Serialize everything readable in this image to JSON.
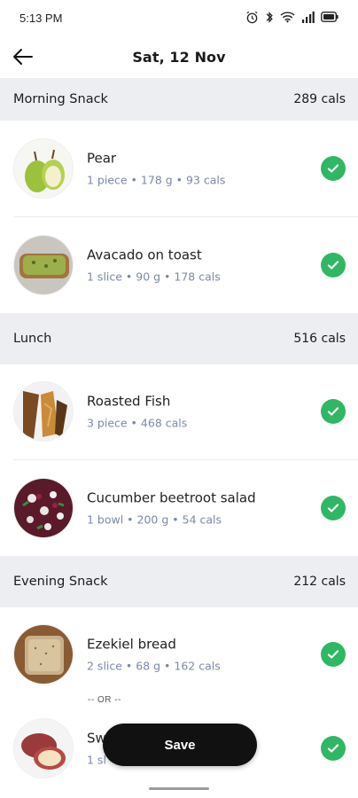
{
  "status_bar": {
    "time": "5:13 PM"
  },
  "header": {
    "title": "Sat, 12 Nov"
  },
  "sections": [
    {
      "name": "Morning Snack",
      "cals": "289 cals",
      "items": [
        {
          "name": "Pear",
          "meta": "1 piece  •  178 g  •  93 cals",
          "icon": "pear-image"
        },
        {
          "name": "Avacado on toast",
          "meta": "1 slice  •  90 g  •  178 cals",
          "icon": "avocado-toast-image"
        }
      ]
    },
    {
      "name": "Lunch",
      "cals": "516 cals",
      "items": [
        {
          "name": "Roasted Fish",
          "meta": "3 piece  •  468 cals",
          "icon": "roasted-fish-image"
        },
        {
          "name": "Cucumber beetroot salad",
          "meta": "1 bowl  •  200 g  •  54 cals",
          "icon": "salad-image"
        }
      ]
    },
    {
      "name": "Evening Snack",
      "cals": "212 cals",
      "items": [
        {
          "name": "Ezekiel bread",
          "meta": "2 slice  •  68 g  •  162 cals",
          "icon": "bread-image"
        },
        {
          "name": "Sw",
          "meta": "1 sl",
          "icon": "sweet-potato-image"
        }
      ],
      "separator": "-- OR --"
    }
  ],
  "save_label": "Save",
  "colors": {
    "check": "#2fb764",
    "section_bg": "#eceef1",
    "meta": "#7b8aa6",
    "button": "#111111"
  }
}
